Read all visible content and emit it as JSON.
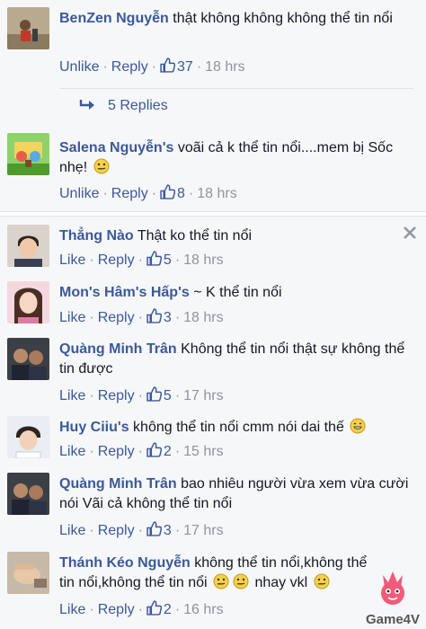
{
  "thread": {
    "comments": [
      {
        "author": "BenZen Nguyễn",
        "text": "thật không không không thể tin nổi",
        "actions": {
          "like": "Unlike",
          "reply": "Reply",
          "likes": "37",
          "time": "18 hrs"
        },
        "replies_label": "5 Replies",
        "avatar_icon": "person-photo-avatar"
      },
      {
        "author": "Salena Nguyễn's",
        "text": "voãi cả k thể tin nổi....mem bị Sốc nhẹ!",
        "actions": {
          "like": "Unlike",
          "reply": "Reply",
          "likes": "8",
          "time": "18 hrs"
        },
        "avatar_icon": "cartoon-avatar"
      },
      {
        "author": "Thẳng Nào",
        "text": "Thật ko thể tin nổi",
        "actions": {
          "like": "Like",
          "reply": "Reply",
          "likes": "5",
          "time": "18 hrs"
        },
        "avatar_icon": "person-photo-avatar"
      },
      {
        "author": "Mon's Hâm's Hấp's",
        "text": "~ K thể tin nổi",
        "actions": {
          "like": "Like",
          "reply": "Reply",
          "likes": "3",
          "time": "18 hrs"
        },
        "avatar_icon": "person-photo-avatar"
      },
      {
        "author": "Quàng Minh Trân",
        "text": "Không thể tin nổi thật sự không thể tin được",
        "actions": {
          "like": "Like",
          "reply": "Reply",
          "likes": "5",
          "time": "17 hrs"
        },
        "avatar_icon": "group-photo-avatar"
      },
      {
        "author": "Huy Ciiu's",
        "text": "không thể tin nổi cmm nói dai thế",
        "actions": {
          "like": "Like",
          "reply": "Reply",
          "likes": "2",
          "time": "15 hrs"
        },
        "avatar_icon": "person-photo-avatar"
      },
      {
        "author": "Quàng Minh Trân",
        "text": "bao nhiêu người vừa xem vừa cười nói Vãi cả không thể tin nổi",
        "actions": {
          "like": "Like",
          "reply": "Reply",
          "likes": "3",
          "time": "17 hrs"
        },
        "avatar_icon": "group-photo-avatar"
      },
      {
        "author": "Thánh Kéo Nguyễn",
        "text": "không thể tin nổi,không thể tin nổi,không thể tin nổi",
        "text_suffix": "nhay vkl",
        "actions": {
          "like": "Like",
          "reply": "Reply",
          "likes": "2",
          "time": "16 hrs"
        },
        "avatar_icon": "hand-photo-avatar"
      }
    ]
  },
  "watermark": {
    "text": "Game4V"
  },
  "colors": {
    "link": "#3b5998",
    "muted": "#90949c",
    "panel": "#f6f7f9"
  }
}
